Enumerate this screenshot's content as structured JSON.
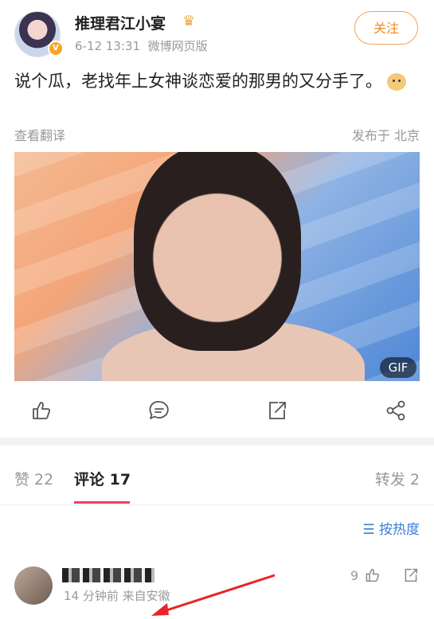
{
  "post": {
    "username": "推理君江小宴",
    "time": "6-12 13:31",
    "source": "微博网页版",
    "follow_label": "关注",
    "text": "说个瓜，老找年上女神谈恋爱的那男的又分手了。",
    "translate_label": "查看翻译",
    "location": "发布于 北京",
    "media_badge": "GIF"
  },
  "tabs": {
    "likes": "赞 22",
    "comments": "评论 17",
    "reposts": "转发 2"
  },
  "sort_label": "按热度",
  "comment": {
    "meta": "14 分钟前   来自安徽",
    "like_count": "9"
  },
  "colors": {
    "accent": "#f03e5a",
    "follow": "#f08a24",
    "link": "#3b7ed9"
  }
}
